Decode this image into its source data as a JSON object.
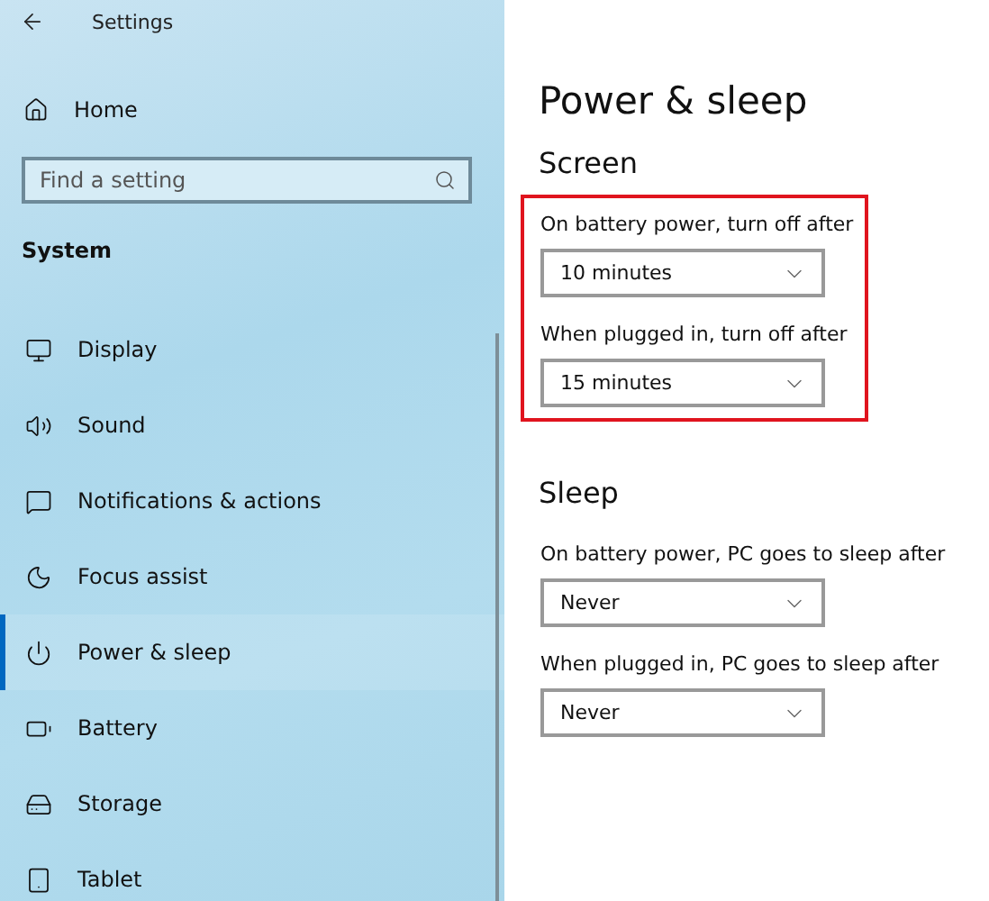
{
  "window": {
    "title": "Settings"
  },
  "sidebar": {
    "home": "Home",
    "search": {
      "placeholder": "Find a setting"
    },
    "group": "System",
    "items": [
      {
        "label": "Display",
        "selected": false
      },
      {
        "label": "Sound",
        "selected": false
      },
      {
        "label": "Notifications & actions",
        "selected": false
      },
      {
        "label": "Focus assist",
        "selected": false
      },
      {
        "label": "Power & sleep",
        "selected": true
      },
      {
        "label": "Battery",
        "selected": false
      },
      {
        "label": "Storage",
        "selected": false
      },
      {
        "label": "Tablet",
        "selected": false
      }
    ]
  },
  "page": {
    "title": "Power & sleep",
    "sections": [
      {
        "heading": "Screen",
        "highlighted": true,
        "settings": [
          {
            "label": "On battery power, turn off after",
            "value": "10 minutes"
          },
          {
            "label": "When plugged in, turn off after",
            "value": "15 minutes"
          }
        ]
      },
      {
        "heading": "Sleep",
        "highlighted": false,
        "settings": [
          {
            "label": "On battery power, PC goes to sleep after",
            "value": "Never"
          },
          {
            "label": "When plugged in, PC goes to sleep after",
            "value": "Never"
          }
        ]
      }
    ]
  }
}
